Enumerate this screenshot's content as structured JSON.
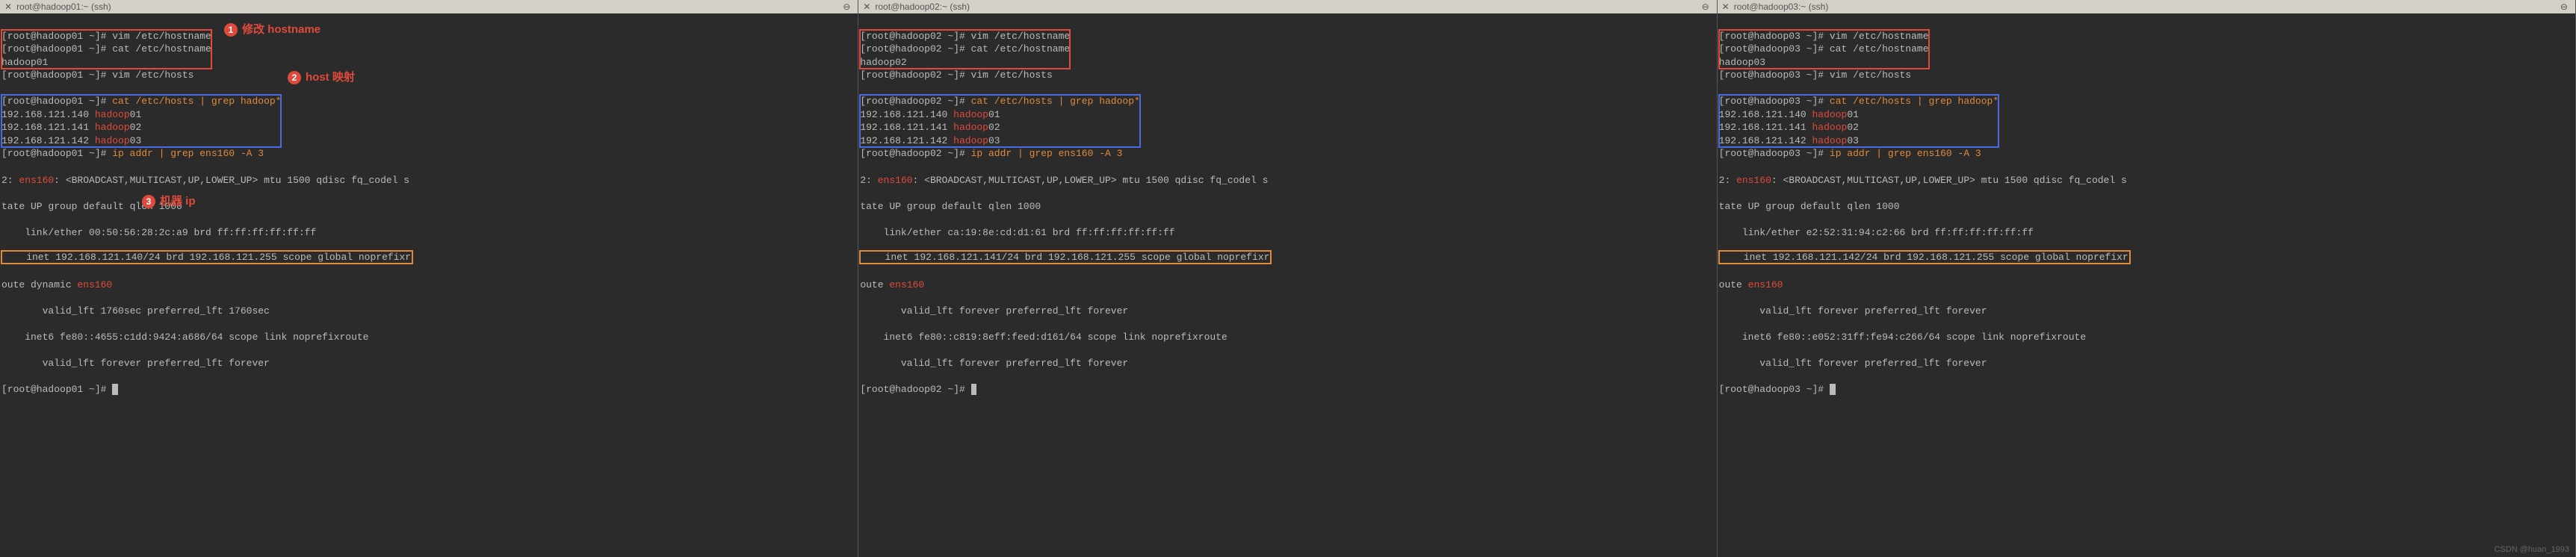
{
  "watermark": "CSDN @huan_1993",
  "annotations": {
    "a1": "修改 hostname",
    "a2": "host 映射",
    "a3": "机器 ip"
  },
  "panes": [
    {
      "tab_title": "root@hadoop01:~ (ssh)",
      "host": "hadoop01",
      "vim_hostname": "[root@hadoop01 ~]# vim /etc/hostname",
      "cat_hostname": "[root@hadoop01 ~]# cat /etc/hostname",
      "hostname": "hadoop01",
      "vim_hosts": "[root@hadoop01 ~]# vim /etc/hosts",
      "cat_hosts_prompt": "[root@hadoop01 ~]# ",
      "cat_hosts_cmd": "cat /etc/hosts | grep hadoop*",
      "hosts": [
        {
          "ip": "192.168.121.140",
          "name": "hadoop",
          "suffix": "01"
        },
        {
          "ip": "192.168.121.141",
          "name": "hadoop",
          "suffix": "02"
        },
        {
          "ip": "192.168.121.142",
          "name": "hadoop",
          "suffix": "03"
        }
      ],
      "ipaddr_prompt": "[root@hadoop01 ~]# ",
      "ipaddr_cmd": "ip addr | grep ens160 -A 3",
      "ens_line1_a": "2: ",
      "ens_line1_b": "ens160",
      "ens_line1_c": ": <BROADCAST,MULTICAST,UP,LOWER_UP> mtu 1500 qdisc fq_codel s",
      "ens_line2": "tate UP group default qlen 1000",
      "link_line": "    link/ether 00:50:56:28:2c:a9 brd ff:ff:ff:ff:ff:ff",
      "inet_line": "    inet 192.168.121.140/24 brd 192.168.121.255 scope global noprefixr",
      "route_a": "oute dynamic ",
      "route_b": "ens160",
      "valid1": "       valid_lft 1760sec preferred_lft 1760sec",
      "inet6": "    inet6 fe80::4655:c1dd:9424:a686/64 scope link noprefixroute",
      "valid2": "       valid_lft forever preferred_lft forever",
      "final_prompt": "[root@hadoop01 ~]# "
    },
    {
      "tab_title": "root@hadoop02:~ (ssh)",
      "host": "hadoop02",
      "vim_hostname": "[root@hadoop02 ~]# vim /etc/hostname",
      "cat_hostname": "[root@hadoop02 ~]# cat /etc/hostname",
      "hostname": "hadoop02",
      "vim_hosts": "[root@hadoop02 ~]# vim /etc/hosts",
      "cat_hosts_prompt": "[root@hadoop02 ~]# ",
      "cat_hosts_cmd": "cat /etc/hosts | grep hadoop*",
      "hosts": [
        {
          "ip": "192.168.121.140",
          "name": "hadoop",
          "suffix": "01"
        },
        {
          "ip": "192.168.121.141",
          "name": "hadoop",
          "suffix": "02"
        },
        {
          "ip": "192.168.121.142",
          "name": "hadoop",
          "suffix": "03"
        }
      ],
      "ipaddr_prompt": "[root@hadoop02 ~]# ",
      "ipaddr_cmd": "ip addr | grep ens160 -A 3",
      "ens_line1_a": "2: ",
      "ens_line1_b": "ens160",
      "ens_line1_c": ": <BROADCAST,MULTICAST,UP,LOWER_UP> mtu 1500 qdisc fq_codel s",
      "ens_line2": "tate UP group default qlen 1000",
      "link_line": "    link/ether ca:19:8e:cd:d1:61 brd ff:ff:ff:ff:ff:ff",
      "inet_line": "    inet 192.168.121.141/24 brd 192.168.121.255 scope global noprefixr",
      "route_a": "oute ",
      "route_b": "ens160",
      "valid1": "       valid_lft forever preferred_lft forever",
      "inet6": "    inet6 fe80::c819:8eff:feed:d161/64 scope link noprefixroute",
      "valid2": "       valid_lft forever preferred_lft forever",
      "final_prompt": "[root@hadoop02 ~]# "
    },
    {
      "tab_title": "root@hadoop03:~ (ssh)",
      "host": "hadoop03",
      "vim_hostname": "[root@hadoop03 ~]# vim /etc/hostname",
      "cat_hostname": "[root@hadoop03 ~]# cat /etc/hostname",
      "hostname": "hadoop03",
      "vim_hosts": "[root@hadoop03 ~]# vim /etc/hosts",
      "cat_hosts_prompt": "[root@hadoop03 ~]# ",
      "cat_hosts_cmd": "cat /etc/hosts | grep hadoop*",
      "hosts": [
        {
          "ip": "192.168.121.140",
          "name": "hadoop",
          "suffix": "01"
        },
        {
          "ip": "192.168.121.141",
          "name": "hadoop",
          "suffix": "02"
        },
        {
          "ip": "192.168.121.142",
          "name": "hadoop",
          "suffix": "03"
        }
      ],
      "ipaddr_prompt": "[root@hadoop03 ~]# ",
      "ipaddr_cmd": "ip addr | grep ens160 -A 3",
      "ens_line1_a": "2: ",
      "ens_line1_b": "ens160",
      "ens_line1_c": ": <BROADCAST,MULTICAST,UP,LOWER_UP> mtu 1500 qdisc fq_codel s",
      "ens_line2": "tate UP group default qlen 1000",
      "link_line": "    link/ether e2:52:31:94:c2:66 brd ff:ff:ff:ff:ff:ff",
      "inet_line": "    inet 192.168.121.142/24 brd 192.168.121.255 scope global noprefixr",
      "route_a": "oute ",
      "route_b": "ens160",
      "valid1": "       valid_lft forever preferred_lft forever",
      "inet6": "    inet6 fe80::e052:31ff:fe94:c266/64 scope link noprefixroute",
      "valid2": "       valid_lft forever preferred_lft forever",
      "final_prompt": "[root@hadoop03 ~]# "
    }
  ]
}
